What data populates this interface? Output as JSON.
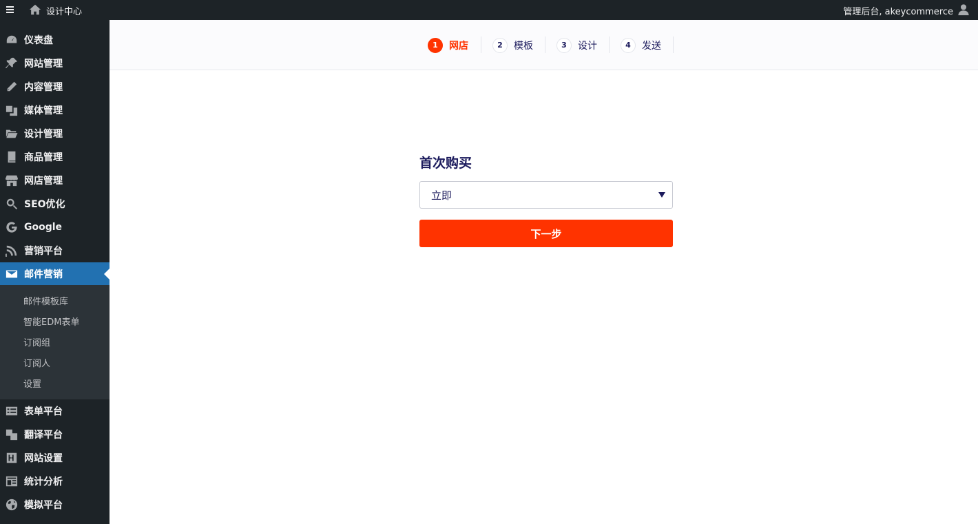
{
  "topbar": {
    "site_title": "设计中心",
    "account_text": "管理后台, akeycommerce"
  },
  "sidebar": {
    "items": [
      {
        "label": "仪表盘",
        "icon": "dashboard-icon"
      },
      {
        "label": "网站管理",
        "icon": "pin-icon"
      },
      {
        "label": "内容管理",
        "icon": "pencil-icon"
      },
      {
        "label": "媒体管理",
        "icon": "media-icon"
      },
      {
        "label": "设计管理",
        "icon": "folder-icon"
      },
      {
        "label": "商品管理",
        "icon": "book-icon"
      },
      {
        "label": "网店管理",
        "icon": "store-icon"
      },
      {
        "label": "SEO优化",
        "icon": "search-icon"
      },
      {
        "label": "Google",
        "icon": "google-icon"
      },
      {
        "label": "营销平台",
        "icon": "rss-icon"
      },
      {
        "label": "邮件营销",
        "icon": "email-icon",
        "active": true
      },
      {
        "label": "表单平台",
        "icon": "form-icon"
      },
      {
        "label": "翻译平台",
        "icon": "translate-icon"
      },
      {
        "label": "网站设置",
        "icon": "settings-icon"
      },
      {
        "label": "统计分析",
        "icon": "analytics-icon"
      },
      {
        "label": "模拟平台",
        "icon": "globe-icon"
      }
    ],
    "submenu": [
      "邮件模板库",
      "智能EDM表单",
      "订阅组",
      "订阅人",
      "设置"
    ]
  },
  "steps": [
    {
      "num": "1",
      "label": "网店",
      "active": true
    },
    {
      "num": "2",
      "label": "模板"
    },
    {
      "num": "3",
      "label": "设计"
    },
    {
      "num": "4",
      "label": "发送"
    }
  ],
  "form": {
    "title": "首次购买",
    "select_value": "立即",
    "next_label": "下一步"
  },
  "colors": {
    "accent": "#ff3300",
    "sidebar_bg": "#1d2327",
    "sidebar_active": "#2271b1",
    "text_dark": "#1b1a5c"
  }
}
